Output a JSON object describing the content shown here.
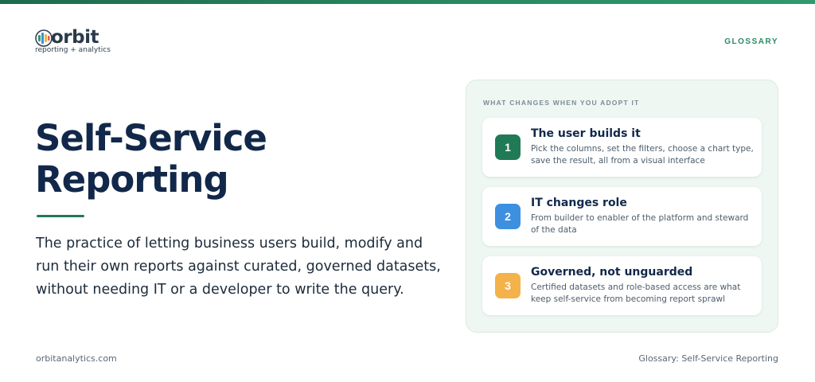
{
  "brand": {
    "name": "orbit",
    "tagline": "reporting + analytics",
    "colors": {
      "green": "#1f7a55",
      "navy": "#12284a",
      "blue": "#3d8fe0",
      "amber": "#f4b24a"
    }
  },
  "header": {
    "section_label": "GLOSSARY"
  },
  "term": {
    "title_line1": "Self-Service",
    "title_line2": "Reporting",
    "definition": "The practice of letting business users build, modify and run their own reports against curated, governed datasets, without needing IT or a developer to write the query."
  },
  "panel": {
    "heading": "WHAT CHANGES WHEN YOU ADOPT IT",
    "items": [
      {
        "number": "1",
        "title": "The user builds it",
        "description": "Pick the columns, set the filters, choose a chart type, save the result, all from a visual interface",
        "color": "#1f7a55"
      },
      {
        "number": "2",
        "title": "IT changes role",
        "description": "From builder to enabler of the platform and steward of the data",
        "color": "#3d8fe0"
      },
      {
        "number": "3",
        "title": "Governed, not unguarded",
        "description": "Certified datasets and role-based access are what keep self-service from becoming report sprawl",
        "color": "#f4b24a"
      }
    ]
  },
  "footer": {
    "website": "orbitanalytics.com",
    "page_label": "Glossary: Self-Service Reporting"
  }
}
